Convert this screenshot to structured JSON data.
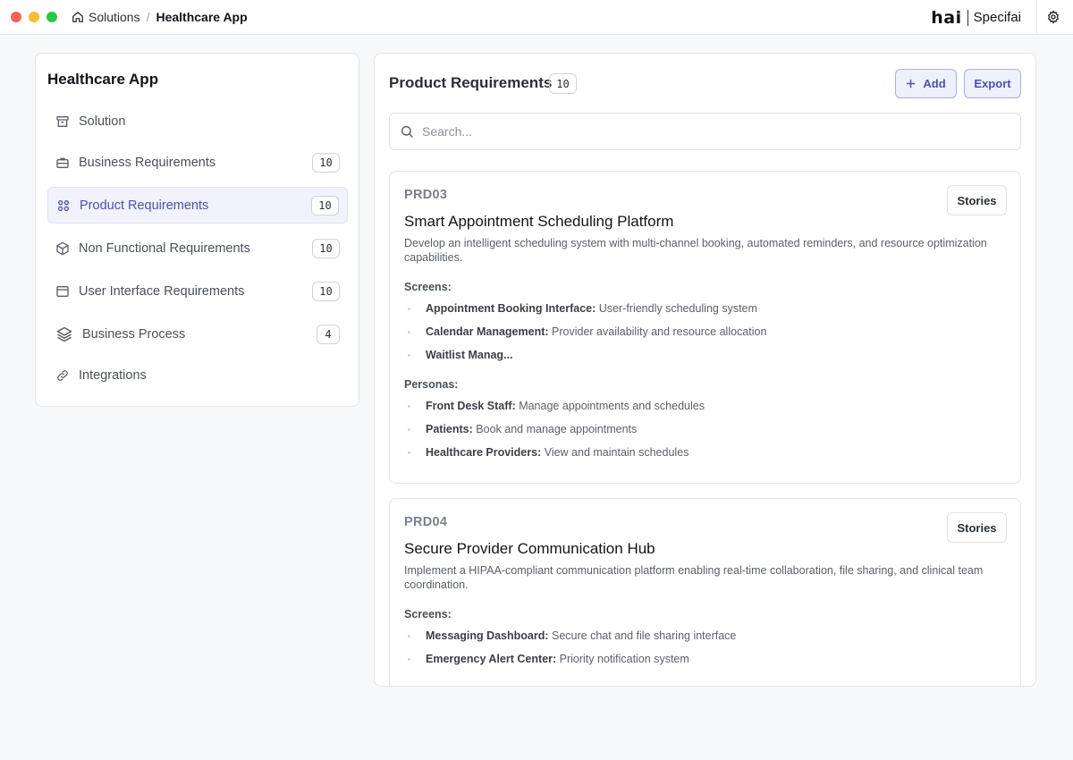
{
  "titlebar": {
    "breadcrumb_root": "Solutions",
    "breadcrumb_separator": "/",
    "breadcrumb_current": "Healthcare App",
    "brand_hai": "hai",
    "brand_name": "Specifai"
  },
  "sidebar": {
    "title": "Healthcare App",
    "items": [
      {
        "label": "Solution",
        "icon": "archive-icon",
        "badge": ""
      },
      {
        "label": "Business Requirements",
        "icon": "briefcase-icon",
        "badge": "10"
      },
      {
        "label": "Product Requirements",
        "icon": "grid-icon",
        "badge": "10",
        "active": true
      },
      {
        "label": "Non Functional Requirements",
        "icon": "cube-icon",
        "badge": "10"
      },
      {
        "label": "User Interface Requirements",
        "icon": "window-icon",
        "badge": "10"
      },
      {
        "label": "Business Process",
        "icon": "layers-icon",
        "badge": "4"
      },
      {
        "label": "Integrations",
        "icon": "link-icon",
        "badge": ""
      }
    ]
  },
  "main": {
    "title": "Product Requirements",
    "count": "10",
    "add_label": "Add",
    "export_label": "Export",
    "search_placeholder": "Search...",
    "cards": [
      {
        "id": "PRD03",
        "title": "Smart Appointment Scheduling Platform",
        "description": "Develop an intelligent scheduling system with multi-channel booking, automated reminders, and resource optimization capabilities.",
        "stories_label": "Stories",
        "screens_label": "Screens:",
        "screens": [
          {
            "name": "Appointment Booking Interface:",
            "detail": "User-friendly scheduling system"
          },
          {
            "name": "Calendar Management:",
            "detail": "Provider availability and resource allocation"
          },
          {
            "name": "Waitlist Manag...",
            "detail": ""
          }
        ],
        "personas_label": "Personas:",
        "personas": [
          {
            "name": "Front Desk Staff:",
            "detail": "Manage appointments and schedules"
          },
          {
            "name": "Patients:",
            "detail": "Book and manage appointments"
          },
          {
            "name": "Healthcare Providers:",
            "detail": "View and maintain schedules"
          }
        ]
      },
      {
        "id": "PRD04",
        "title": "Secure Provider Communication Hub",
        "description": "Implement a HIPAA-compliant communication platform enabling real-time collaboration, file sharing, and clinical team coordination.",
        "stories_label": "Stories",
        "screens_label": "Screens:",
        "screens": [
          {
            "name": "Messaging Dashboard:",
            "detail": "Secure chat and file sharing interface"
          },
          {
            "name": "Emergency Alert Center:",
            "detail": "Priority notification system"
          }
        ]
      }
    ]
  }
}
